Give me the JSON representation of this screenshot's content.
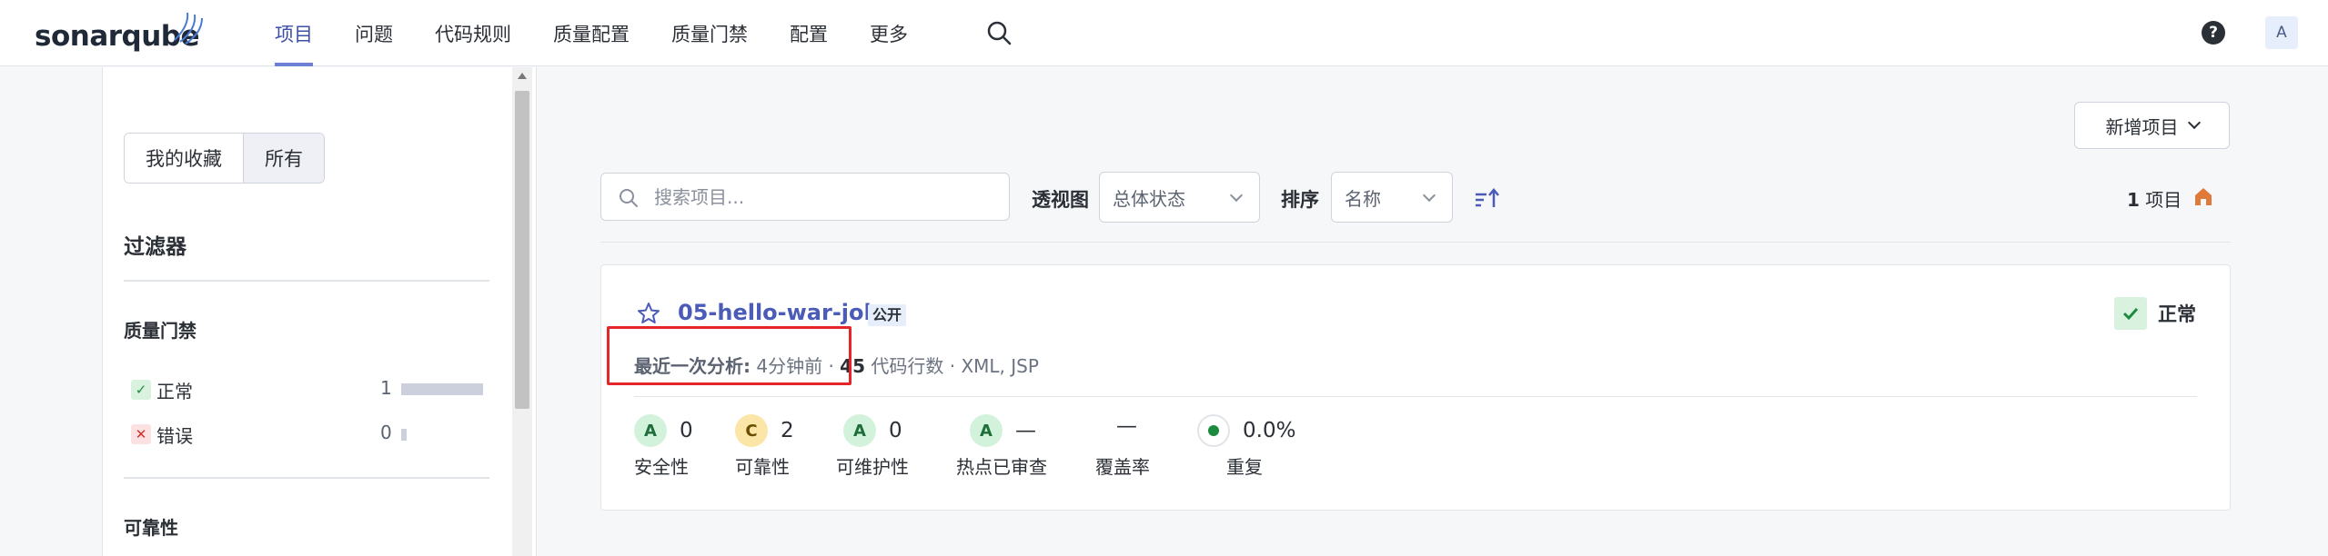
{
  "brand": {
    "name": "sonarqube"
  },
  "nav": {
    "items": [
      {
        "label": "项目",
        "active": true
      },
      {
        "label": "问题"
      },
      {
        "label": "代码规则"
      },
      {
        "label": "质量配置"
      },
      {
        "label": "质量门禁"
      },
      {
        "label": "配置"
      },
      {
        "label": "更多"
      }
    ],
    "help_icon": "?",
    "avatar_initial": "A"
  },
  "sidebar": {
    "favorites_toggle": {
      "favorites_label": "我的收藏",
      "all_label": "所有",
      "selected": "所有"
    },
    "filters_title": "过滤器",
    "quality_gate": {
      "title": "质量门禁",
      "items": [
        {
          "label": "正常",
          "count": "1",
          "icon": "check-icon",
          "ratio": 1.0
        },
        {
          "label": "错误",
          "count": "0",
          "icon": "cross-icon",
          "ratio": 0.0
        }
      ]
    },
    "reliability_title": "可靠性"
  },
  "toolbar": {
    "new_project_label": "新增项目",
    "search_placeholder": "搜索项目...",
    "perspective_label": "透视图",
    "perspective_value": "总体状态",
    "sort_label": "排序",
    "sort_value": "名称",
    "project_count": "1",
    "project_count_unit": "项目"
  },
  "project": {
    "name": "05-hello-war-job",
    "visibility": "公开",
    "quality_gate_status": "正常",
    "last_analysis_label": "最近一次分析:",
    "last_analysis_value": "4分钟前",
    "separator": "·",
    "loc_value": "45",
    "loc_label": "代码行数",
    "languages": "XML, JSP",
    "metrics": [
      {
        "rating": "A",
        "value": "0",
        "label": "安全性"
      },
      {
        "rating": "C",
        "value": "2",
        "label": "可靠性"
      },
      {
        "rating": "A",
        "value": "0",
        "label": "可维护性"
      },
      {
        "rating": "A",
        "value": "—",
        "label": "热点已审查"
      },
      {
        "rating": "",
        "value": "—",
        "label": "覆盖率"
      },
      {
        "rating": "",
        "value": "0.0%",
        "label": "重复"
      }
    ]
  },
  "colors": {
    "accent": "#4a5bb8",
    "ok_green": "#1c8a3f",
    "error_red": "#d03030",
    "highlight_red": "#e4262b"
  }
}
